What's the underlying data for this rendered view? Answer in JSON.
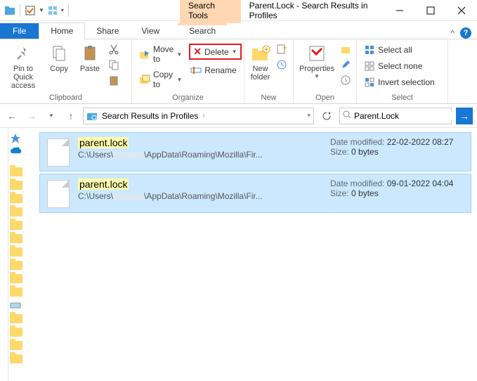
{
  "titlebar": {
    "context_tab": "Search Tools",
    "title": "Parent.Lock - Search Results in Profiles"
  },
  "ribbon_tabs": {
    "file": "File",
    "home": "Home",
    "share": "Share",
    "view": "View",
    "search": "Search"
  },
  "ribbon": {
    "clipboard_group": "Clipboard",
    "organize_group": "Organize",
    "new_group": "New",
    "open_group": "Open",
    "select_group": "Select",
    "pin": "Pin to Quick access",
    "copy": "Copy",
    "paste": "Paste",
    "move_to": "Move to",
    "copy_to": "Copy to",
    "delete": "Delete",
    "rename": "Rename",
    "new_folder": "New folder",
    "properties": "Properties",
    "select_all": "Select all",
    "select_none": "Select none",
    "invert": "Invert selection"
  },
  "nav": {
    "location": "Search Results in Profiles",
    "search_value": "Parent.Lock"
  },
  "results": [
    {
      "name": "parent.lock",
      "path_prefix": "C:\\Users\\",
      "path_suffix": "\\AppData\\Roaming\\Mozilla\\Fir...",
      "date_label": "Date modified:",
      "date": "22-02-2022 08:27",
      "size_label": "Size:",
      "size": "0 bytes"
    },
    {
      "name": "parent.lock",
      "path_prefix": "C:\\Users\\",
      "path_suffix": "\\AppData\\Roaming\\Mozilla\\Fir...",
      "date_label": "Date modified:",
      "date": "09-01-2022 04:04",
      "size_label": "Size:",
      "size": "0 bytes"
    }
  ]
}
